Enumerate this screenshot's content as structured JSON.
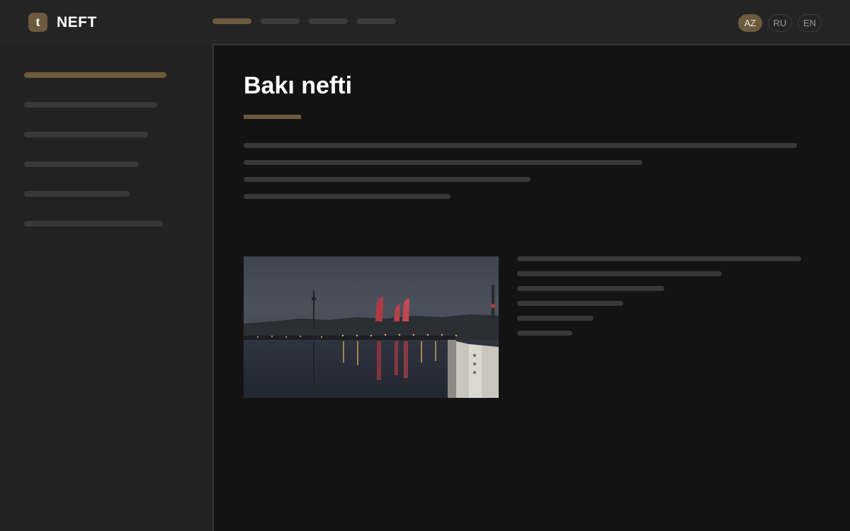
{
  "header": {
    "logo_letter": "t",
    "brand": "NEFT",
    "nav_items": [
      "",
      "",
      "",
      ""
    ],
    "languages": [
      "AZ",
      "RU",
      "EN"
    ],
    "active_language": "AZ"
  },
  "sidebar": {
    "items": [
      "",
      "",
      "",
      "",
      "",
      ""
    ]
  },
  "main": {
    "title": "Bakı nefti",
    "image": {
      "subject": "Baku waterfront at dusk with Flame Towers"
    }
  },
  "colors": {
    "accent": "#6b5a3d",
    "background": "#222222",
    "panel": "#131313",
    "placeholder": "#383838"
  }
}
